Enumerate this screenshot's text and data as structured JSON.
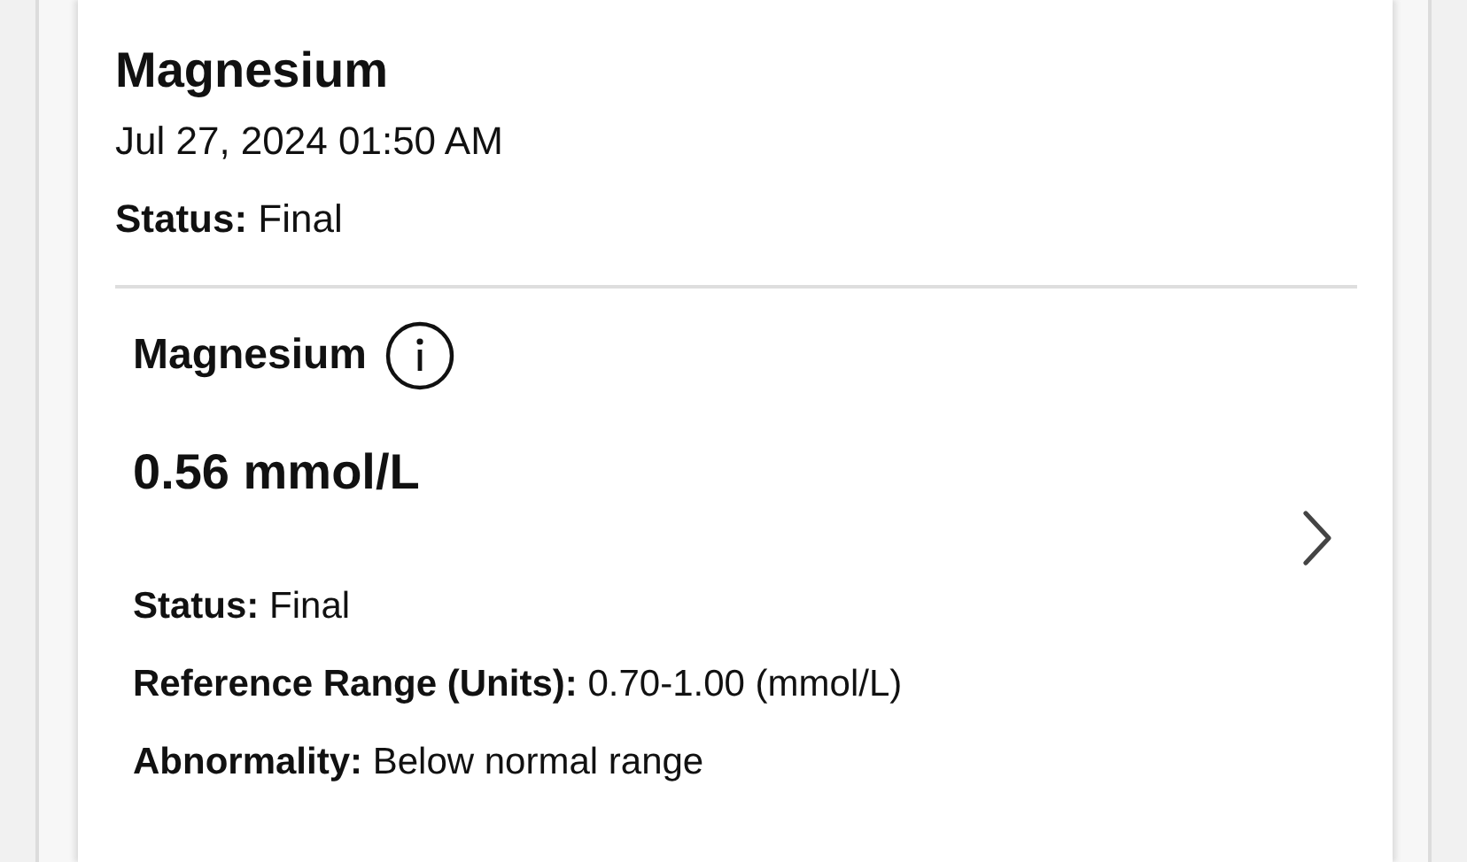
{
  "report": {
    "title": "Magnesium",
    "datetime": "Jul 27, 2024 01:50 AM",
    "status": "**Status:** Final"
  },
  "result": {
    "name": "Magnesium",
    "value": "0.56 mmol/L",
    "details": [
      "**Status:** Final",
      "**Reference Range (Units):** 0.70-1.00 (mmol/L)",
      "**Abnormality:** Below normal range"
    ]
  }
}
